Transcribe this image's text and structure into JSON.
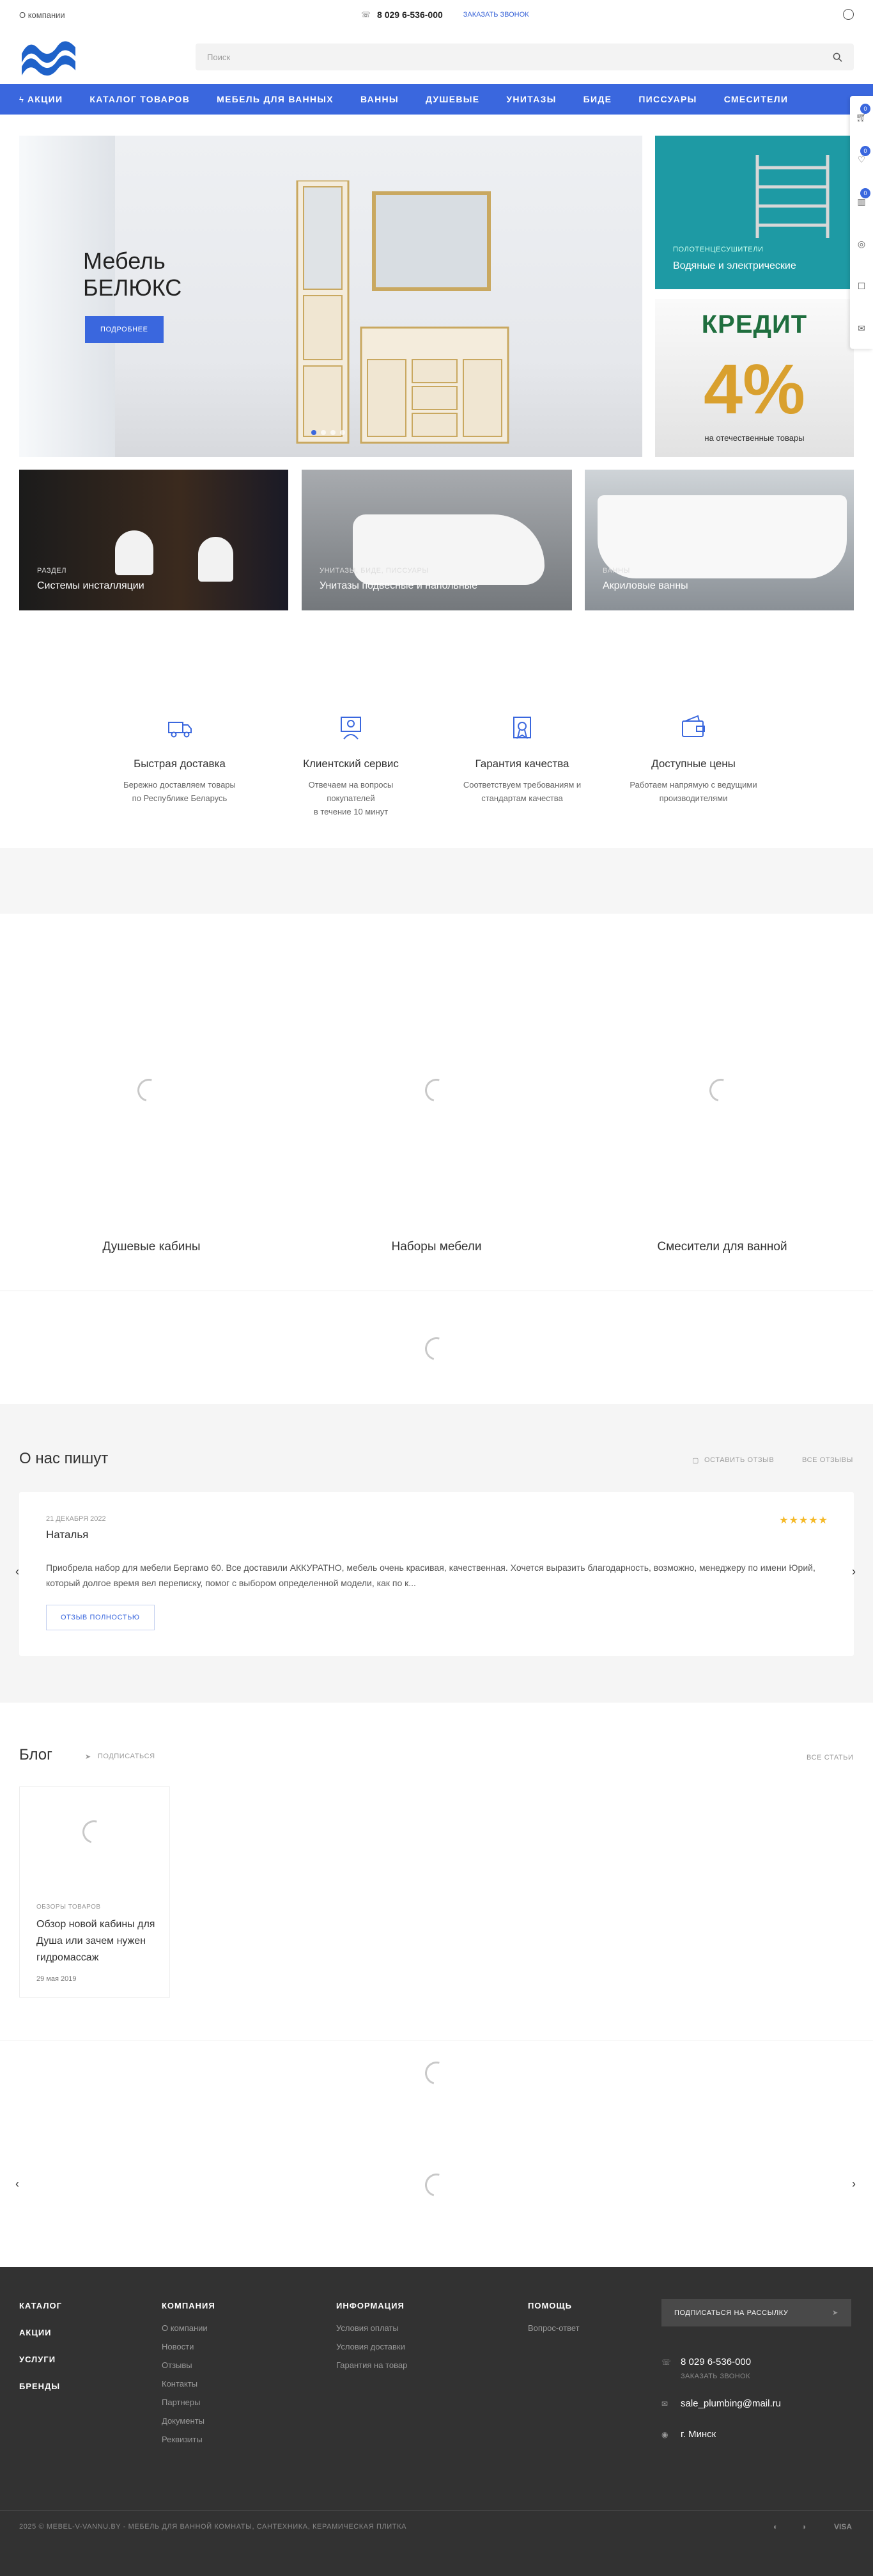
{
  "topbar": {
    "about": "О компании",
    "phone": "8 029 6-536-000",
    "callback": "ЗАКАЗАТЬ ЗВОНОК"
  },
  "header": {
    "search_placeholder": "Поиск"
  },
  "nav": [
    "АКЦИИ",
    "КАТАЛОГ ТОВАРОВ",
    "МЕБЕЛЬ ДЛЯ ВАННЫХ",
    "ВАННЫ",
    "ДУШЕВЫЕ",
    "УНИТАЗЫ",
    "БИДЕ",
    "ПИССУАРЫ",
    "СМЕСИТЕЛИ"
  ],
  "side": {
    "cart": "0",
    "fav": "0",
    "compare": "0"
  },
  "hero": {
    "title_line1": "Мебель",
    "title_line2": "БЕЛЮКС",
    "button": "ПОДРОБНЕЕ"
  },
  "promo1": {
    "sub": "ПОЛОТЕНЦЕСУШИТЕЛИ",
    "title": "Водяные и электрические"
  },
  "promo2": {
    "kredit": "КРЕДИТ",
    "percent": "4%",
    "caption": "на отечественные товары"
  },
  "cats": [
    {
      "sub": "РАЗДЕЛ",
      "name": "Системы инсталляции"
    },
    {
      "sub": "УНИТАЗЫ, БИДЕ, ПИССУАРЫ",
      "name": "Унитазы подвесные и напольные"
    },
    {
      "sub": "ВАННЫ",
      "name": "Акриловые ванны"
    }
  ],
  "advantages": [
    {
      "title": "Быстрая доставка",
      "desc": "Бережно доставляем товары\nпо Республике Беларусь"
    },
    {
      "title": "Клиентский сервис",
      "desc": "Отвечаем на вопросы\nпокупателей\nв течение 10 минут"
    },
    {
      "title": "Гарантия качества",
      "desc": "Соответствуем требованиям и\nстандартам качества"
    },
    {
      "title": "Доступные цены",
      "desc": "Работаем напрямую с ведущими\nпроизводителями"
    }
  ],
  "tiles": [
    "Душевые кабины",
    "Наборы мебели",
    "Смесители для ванной"
  ],
  "reviews": {
    "title": "О нас пишут",
    "leave": "ОСТАВИТЬ ОТЗЫВ",
    "all": "ВСЕ ОТЗЫВЫ",
    "date": "21 ДЕКАБРЯ 2022",
    "name": "Наталья",
    "stars": "★★★★★",
    "text": "Приобрела набор для мебели Бергамо 60. Все доставили АККУРАТНО, мебель очень красивая, качественная. Хочется выразить благодарность, возможно, менеджеру по имени Юрий, который долгое время вел переписку, помог с выбором определенной модели, как по к...",
    "more": "ОТЗЫВ ПОЛНОСТЬЮ"
  },
  "blog": {
    "title": "Блог",
    "subscribe": "ПОДПИСАТЬСЯ",
    "all": "ВСЕ СТАТЬИ",
    "card": {
      "category": "ОБЗОРЫ ТОВАРОВ",
      "title": "Обзор новой кабины для Душа или зачем нужен гидромассаж",
      "date": "29 мая 2019"
    }
  },
  "footer": {
    "main": [
      "КАТАЛОГ",
      "АКЦИИ",
      "УСЛУГИ",
      "БРЕНДЫ"
    ],
    "company": {
      "title": "КОМПАНИЯ",
      "items": [
        "О компании",
        "Новости",
        "Отзывы",
        "Контакты",
        "Партнеры",
        "Документы",
        "Реквизиты"
      ]
    },
    "info": {
      "title": "ИНФОРМАЦИЯ",
      "items": [
        "Условия оплаты",
        "Условия доставки",
        "Гарантия на товар"
      ]
    },
    "help": {
      "title": "ПОМОЩЬ",
      "items": [
        "Вопрос-ответ"
      ]
    },
    "subscribe": "ПОДПИСАТЬСЯ НА РАССЫЛКУ",
    "phone": "8 029 6-536-000",
    "callback": "ЗАКАЗАТЬ ЗВОНОК",
    "email": "sale_plumbing@mail.ru",
    "city": "г. Минск",
    "copyright": "2025 © MEBEL-V-VANNU.BY - МЕБЕЛЬ ДЛЯ ВАННОЙ КОМНАТЫ, САНТЕХНИКА, КЕРАМИЧЕСКАЯ ПЛИТКА",
    "visa": "VISA"
  },
  "colors": {
    "accent": "#3a67de",
    "footer": "#323232"
  }
}
